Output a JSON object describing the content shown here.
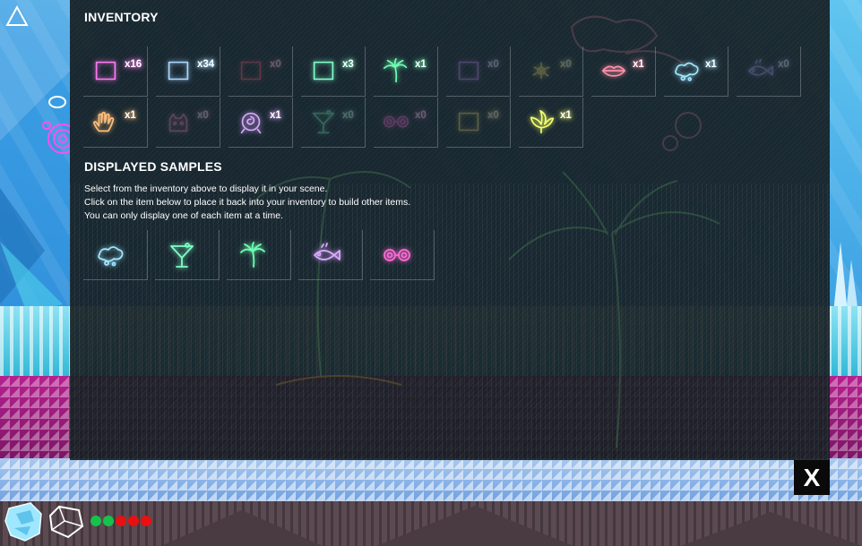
{
  "inventory": {
    "heading": "INVENTORY",
    "items": [
      {
        "icon": "square-sample-icon",
        "count": "x16",
        "color": "#ff79f2",
        "empty": false
      },
      {
        "icon": "square-sample-icon",
        "count": "x34",
        "color": "#a8d8ff",
        "empty": false
      },
      {
        "icon": "square-sample-icon",
        "count": "x0",
        "color": "#ff5a7a",
        "empty": true
      },
      {
        "icon": "square-sample-icon",
        "count": "x3",
        "color": "#7dffc6",
        "empty": false
      },
      {
        "icon": "palm-tree-icon",
        "count": "x1",
        "color": "#6dffb3",
        "empty": false
      },
      {
        "icon": "square-sample-icon",
        "count": "x0",
        "color": "#c48cff",
        "empty": true
      },
      {
        "icon": "splat-icon",
        "count": "x0",
        "color": "#ffe26a",
        "empty": true
      },
      {
        "icon": "lips-icon",
        "count": "x1",
        "color": "#ff8fa8",
        "empty": false
      },
      {
        "icon": "cloud-icon",
        "count": "x1",
        "color": "#9fe6ff",
        "empty": false
      },
      {
        "icon": "fish-icon",
        "count": "x0",
        "color": "#a8a2ff",
        "empty": true
      },
      {
        "icon": "hand-icon",
        "count": "x1",
        "color": "#ffbf7a",
        "empty": false
      },
      {
        "icon": "cat-icon",
        "count": "x0",
        "color": "#ff8fc4",
        "empty": true
      },
      {
        "icon": "rose-icon",
        "count": "x1",
        "color": "#d9a6ff",
        "empty": false
      },
      {
        "icon": "martini-icon",
        "count": "x0",
        "color": "#7dffc6",
        "empty": true
      },
      {
        "icon": "glasses-icon",
        "count": "x0",
        "color": "#ff6ad5",
        "empty": true
      },
      {
        "icon": "square-sample-icon",
        "count": "x0",
        "color": "#ffe26a",
        "empty": true
      },
      {
        "icon": "leaf-plant-icon",
        "count": "x1",
        "color": "#f3ff6a",
        "empty": false
      }
    ]
  },
  "displayed": {
    "heading": "DISPLAYED SAMPLES",
    "instructions": [
      "Select from the inventory above to display it in your scene.",
      "Click on the item below to place it back into your inventory to build other items.",
      "You can only display one of each item at a time."
    ],
    "items": [
      {
        "icon": "cloud-icon",
        "color": "#9fe6ff"
      },
      {
        "icon": "martini-icon",
        "color": "#7dffc6"
      },
      {
        "icon": "palm-tree-icon",
        "color": "#6dffb3"
      },
      {
        "icon": "fish-icon",
        "color": "#d9a6ff"
      },
      {
        "icon": "glasses-icon",
        "color": "#ff6ad5"
      }
    ]
  },
  "close_button": "X",
  "hud": {
    "status_dots": [
      "#16c24a",
      "#16c24a",
      "#e81010",
      "#e81010",
      "#e81010"
    ]
  }
}
